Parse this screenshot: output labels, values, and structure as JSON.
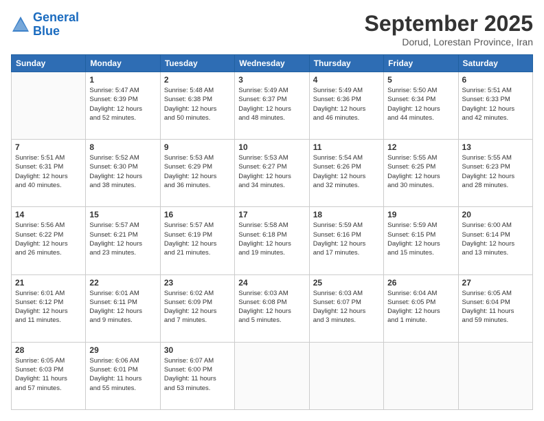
{
  "logo": {
    "line1": "General",
    "line2": "Blue"
  },
  "title": "September 2025",
  "subtitle": "Dorud, Lorestan Province, Iran",
  "headers": [
    "Sunday",
    "Monday",
    "Tuesday",
    "Wednesday",
    "Thursday",
    "Friday",
    "Saturday"
  ],
  "weeks": [
    [
      {
        "day": "",
        "info": ""
      },
      {
        "day": "1",
        "info": "Sunrise: 5:47 AM\nSunset: 6:39 PM\nDaylight: 12 hours\nand 52 minutes."
      },
      {
        "day": "2",
        "info": "Sunrise: 5:48 AM\nSunset: 6:38 PM\nDaylight: 12 hours\nand 50 minutes."
      },
      {
        "day": "3",
        "info": "Sunrise: 5:49 AM\nSunset: 6:37 PM\nDaylight: 12 hours\nand 48 minutes."
      },
      {
        "day": "4",
        "info": "Sunrise: 5:49 AM\nSunset: 6:36 PM\nDaylight: 12 hours\nand 46 minutes."
      },
      {
        "day": "5",
        "info": "Sunrise: 5:50 AM\nSunset: 6:34 PM\nDaylight: 12 hours\nand 44 minutes."
      },
      {
        "day": "6",
        "info": "Sunrise: 5:51 AM\nSunset: 6:33 PM\nDaylight: 12 hours\nand 42 minutes."
      }
    ],
    [
      {
        "day": "7",
        "info": "Sunrise: 5:51 AM\nSunset: 6:31 PM\nDaylight: 12 hours\nand 40 minutes."
      },
      {
        "day": "8",
        "info": "Sunrise: 5:52 AM\nSunset: 6:30 PM\nDaylight: 12 hours\nand 38 minutes."
      },
      {
        "day": "9",
        "info": "Sunrise: 5:53 AM\nSunset: 6:29 PM\nDaylight: 12 hours\nand 36 minutes."
      },
      {
        "day": "10",
        "info": "Sunrise: 5:53 AM\nSunset: 6:27 PM\nDaylight: 12 hours\nand 34 minutes."
      },
      {
        "day": "11",
        "info": "Sunrise: 5:54 AM\nSunset: 6:26 PM\nDaylight: 12 hours\nand 32 minutes."
      },
      {
        "day": "12",
        "info": "Sunrise: 5:55 AM\nSunset: 6:25 PM\nDaylight: 12 hours\nand 30 minutes."
      },
      {
        "day": "13",
        "info": "Sunrise: 5:55 AM\nSunset: 6:23 PM\nDaylight: 12 hours\nand 28 minutes."
      }
    ],
    [
      {
        "day": "14",
        "info": "Sunrise: 5:56 AM\nSunset: 6:22 PM\nDaylight: 12 hours\nand 26 minutes."
      },
      {
        "day": "15",
        "info": "Sunrise: 5:57 AM\nSunset: 6:21 PM\nDaylight: 12 hours\nand 23 minutes."
      },
      {
        "day": "16",
        "info": "Sunrise: 5:57 AM\nSunset: 6:19 PM\nDaylight: 12 hours\nand 21 minutes."
      },
      {
        "day": "17",
        "info": "Sunrise: 5:58 AM\nSunset: 6:18 PM\nDaylight: 12 hours\nand 19 minutes."
      },
      {
        "day": "18",
        "info": "Sunrise: 5:59 AM\nSunset: 6:16 PM\nDaylight: 12 hours\nand 17 minutes."
      },
      {
        "day": "19",
        "info": "Sunrise: 5:59 AM\nSunset: 6:15 PM\nDaylight: 12 hours\nand 15 minutes."
      },
      {
        "day": "20",
        "info": "Sunrise: 6:00 AM\nSunset: 6:14 PM\nDaylight: 12 hours\nand 13 minutes."
      }
    ],
    [
      {
        "day": "21",
        "info": "Sunrise: 6:01 AM\nSunset: 6:12 PM\nDaylight: 12 hours\nand 11 minutes."
      },
      {
        "day": "22",
        "info": "Sunrise: 6:01 AM\nSunset: 6:11 PM\nDaylight: 12 hours\nand 9 minutes."
      },
      {
        "day": "23",
        "info": "Sunrise: 6:02 AM\nSunset: 6:09 PM\nDaylight: 12 hours\nand 7 minutes."
      },
      {
        "day": "24",
        "info": "Sunrise: 6:03 AM\nSunset: 6:08 PM\nDaylight: 12 hours\nand 5 minutes."
      },
      {
        "day": "25",
        "info": "Sunrise: 6:03 AM\nSunset: 6:07 PM\nDaylight: 12 hours\nand 3 minutes."
      },
      {
        "day": "26",
        "info": "Sunrise: 6:04 AM\nSunset: 6:05 PM\nDaylight: 12 hours\nand 1 minute."
      },
      {
        "day": "27",
        "info": "Sunrise: 6:05 AM\nSunset: 6:04 PM\nDaylight: 11 hours\nand 59 minutes."
      }
    ],
    [
      {
        "day": "28",
        "info": "Sunrise: 6:05 AM\nSunset: 6:03 PM\nDaylight: 11 hours\nand 57 minutes."
      },
      {
        "day": "29",
        "info": "Sunrise: 6:06 AM\nSunset: 6:01 PM\nDaylight: 11 hours\nand 55 minutes."
      },
      {
        "day": "30",
        "info": "Sunrise: 6:07 AM\nSunset: 6:00 PM\nDaylight: 11 hours\nand 53 minutes."
      },
      {
        "day": "",
        "info": ""
      },
      {
        "day": "",
        "info": ""
      },
      {
        "day": "",
        "info": ""
      },
      {
        "day": "",
        "info": ""
      }
    ]
  ]
}
